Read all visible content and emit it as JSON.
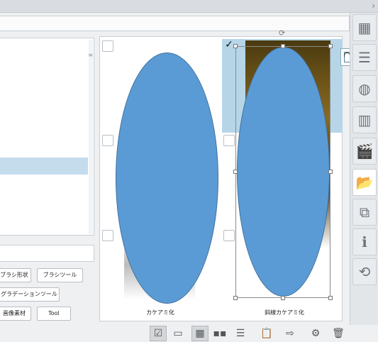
{
  "window": {
    "expand_chevron": "›"
  },
  "tags": {
    "brush_shape": "ブラシ形状",
    "brush_tool": "ブラシツール",
    "gradation_tool": "グラデーションツール",
    "image_material": "画像素材",
    "tool": "Tool"
  },
  "materials": [
    {
      "caption": "カケアミ化",
      "checked": false
    },
    {
      "caption": "斜線カケアミ化",
      "checked": true
    }
  ],
  "selection": {
    "check_mark": "✓",
    "rotate_handle": "⟳"
  },
  "shape_color": "#5b9bd5",
  "selection_color": "#b6d6e8",
  "sidebar_icons": [
    "thumbnail-grid-icon",
    "list-icon",
    "circle-icon",
    "folder-stack-icon",
    "clapperboard-icon",
    "folder-import-icon",
    "window-icon",
    "info-icon",
    "sync-icon"
  ],
  "bottombar": {
    "icons": {
      "check_view": "☑",
      "card_view": "▭",
      "large_grid": "▦",
      "small_grid": "▪▪",
      "list_view": "☰",
      "paste": "📋",
      "export": "⇨",
      "settings": "⚙",
      "trash": "🗑"
    }
  }
}
